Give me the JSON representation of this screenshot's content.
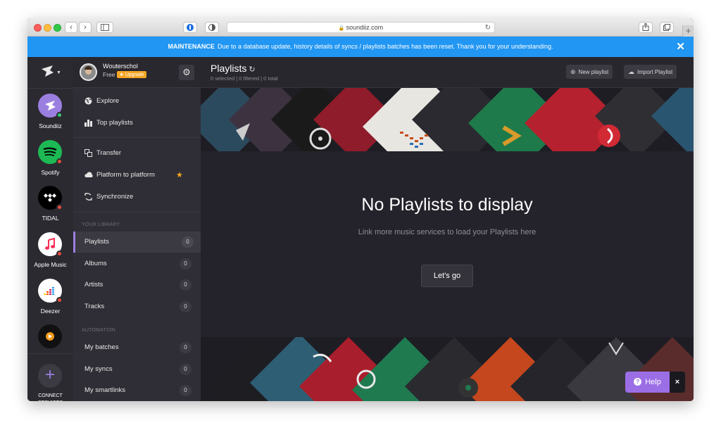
{
  "browser": {
    "url": "soundiiz.com",
    "back_icon": "chevron-left-icon",
    "forward_icon": "chevron-right-icon"
  },
  "banner": {
    "label": "MAINTENANCE",
    "message": "Due to a database update, history details of syncs / playlists batches has been reset. Thank you for your understanding.",
    "close": "✕"
  },
  "services": [
    {
      "name": "Soundiiz",
      "color": "#9b7fe0",
      "status": "#2ecc71"
    },
    {
      "name": "Spotify",
      "color": "#1db954",
      "status": "#e74c3c"
    },
    {
      "name": "TIDAL",
      "color": "#000000",
      "status": "#e74c3c"
    },
    {
      "name": "Apple Music",
      "color": "#ffffff",
      "status": "#e74c3c"
    },
    {
      "name": "Deezer",
      "color": "#ffffff",
      "status": "#e74c3c"
    }
  ],
  "connect": {
    "label": "CONNECT SERVICES"
  },
  "user": {
    "name": "Wouterschol",
    "plan": "Free",
    "upgrade": "Upgrade"
  },
  "nav": {
    "explore": "Explore",
    "top_playlists": "Top playlists",
    "transfer": "Transfer",
    "platform_to_platform": "Platform to platform",
    "synchronize": "Synchronize"
  },
  "library": {
    "heading": "YOUR LIBRARY",
    "items": [
      {
        "label": "Playlists",
        "count": "0"
      },
      {
        "label": "Albums",
        "count": "0"
      },
      {
        "label": "Artists",
        "count": "0"
      },
      {
        "label": "Tracks",
        "count": "0"
      }
    ]
  },
  "automation": {
    "heading": "AUTOMATION",
    "items": [
      {
        "label": "My batches",
        "count": "0"
      },
      {
        "label": "My syncs",
        "count": "0"
      },
      {
        "label": "My smartlinks",
        "count": "0"
      }
    ]
  },
  "main": {
    "title": "Playlists",
    "subtitle": "0 selected | 0 filtered | 0 total",
    "new_playlist": "New playlist",
    "import_playlist": "Import Playlist",
    "empty_title": "No Playlists to display",
    "empty_desc": "Link more music services to load your Playlists here",
    "cta": "Let's go"
  },
  "help": {
    "label": "Help",
    "close": "×"
  },
  "colors": {
    "accent": "#9b7fe0",
    "banner": "#2196f3",
    "star": "#f5a623"
  }
}
